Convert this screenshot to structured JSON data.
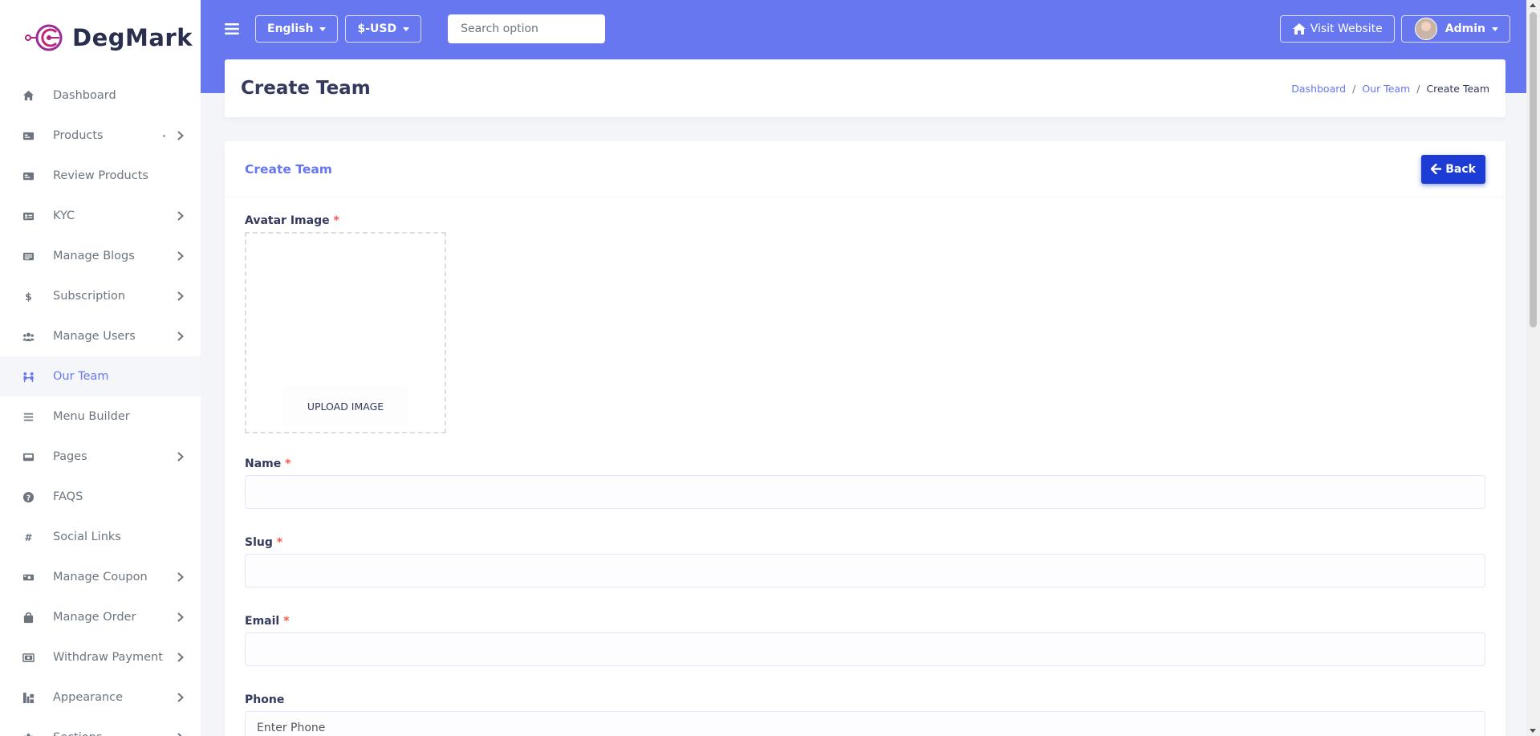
{
  "brand": {
    "name": "DegMark"
  },
  "sidebar": {
    "items": [
      {
        "label": "Dashboard",
        "icon": "home-icon",
        "chevron": false
      },
      {
        "label": "Products",
        "icon": "product-icon",
        "chevron": true,
        "dot": true
      },
      {
        "label": "Review Products",
        "icon": "review-icon",
        "chevron": false
      },
      {
        "label": "KYC",
        "icon": "id-card-icon",
        "chevron": true
      },
      {
        "label": "Manage Blogs",
        "icon": "blog-icon",
        "chevron": true
      },
      {
        "label": "Subscription",
        "icon": "dollar-icon",
        "chevron": true
      },
      {
        "label": "Manage Users",
        "icon": "users-icon",
        "chevron": true
      },
      {
        "label": "Our Team",
        "icon": "team-icon",
        "chevron": false,
        "active": true
      },
      {
        "label": "Menu Builder",
        "icon": "bars-icon",
        "chevron": false
      },
      {
        "label": "Pages",
        "icon": "page-icon",
        "chevron": true
      },
      {
        "label": "FAQS",
        "icon": "question-icon",
        "chevron": false
      },
      {
        "label": "Social Links",
        "icon": "hashtag-icon",
        "chevron": false
      },
      {
        "label": "Manage Coupon",
        "icon": "coupon-icon",
        "chevron": true
      },
      {
        "label": "Manage Order",
        "icon": "bag-icon",
        "chevron": true
      },
      {
        "label": "Withdraw Payment",
        "icon": "money-icon",
        "chevron": true
      },
      {
        "label": "Appearance",
        "icon": "appearance-icon",
        "chevron": true
      },
      {
        "label": "Sections",
        "icon": "puzzle-icon",
        "chevron": true
      }
    ]
  },
  "topbar": {
    "language": "English",
    "currency": "$-USD",
    "search_placeholder": "Search option",
    "visit_website": "Visit Website",
    "user": "Admin"
  },
  "page": {
    "title": "Create Team",
    "breadcrumb": [
      "Dashboard",
      "Our Team",
      "Create Team"
    ]
  },
  "form": {
    "card_title": "Create Team",
    "back_label": "Back",
    "avatar_label": "Avatar Image",
    "upload_label": "UPLOAD IMAGE",
    "name_label": "Name",
    "slug_label": "Slug",
    "email_label": "Email",
    "phone_label": "Phone",
    "phone_placeholder": "Enter Phone",
    "required_mark": "*"
  },
  "colors": {
    "primary": "#6777ef",
    "back_button": "#1d3cd6",
    "required": "#fc544b"
  }
}
